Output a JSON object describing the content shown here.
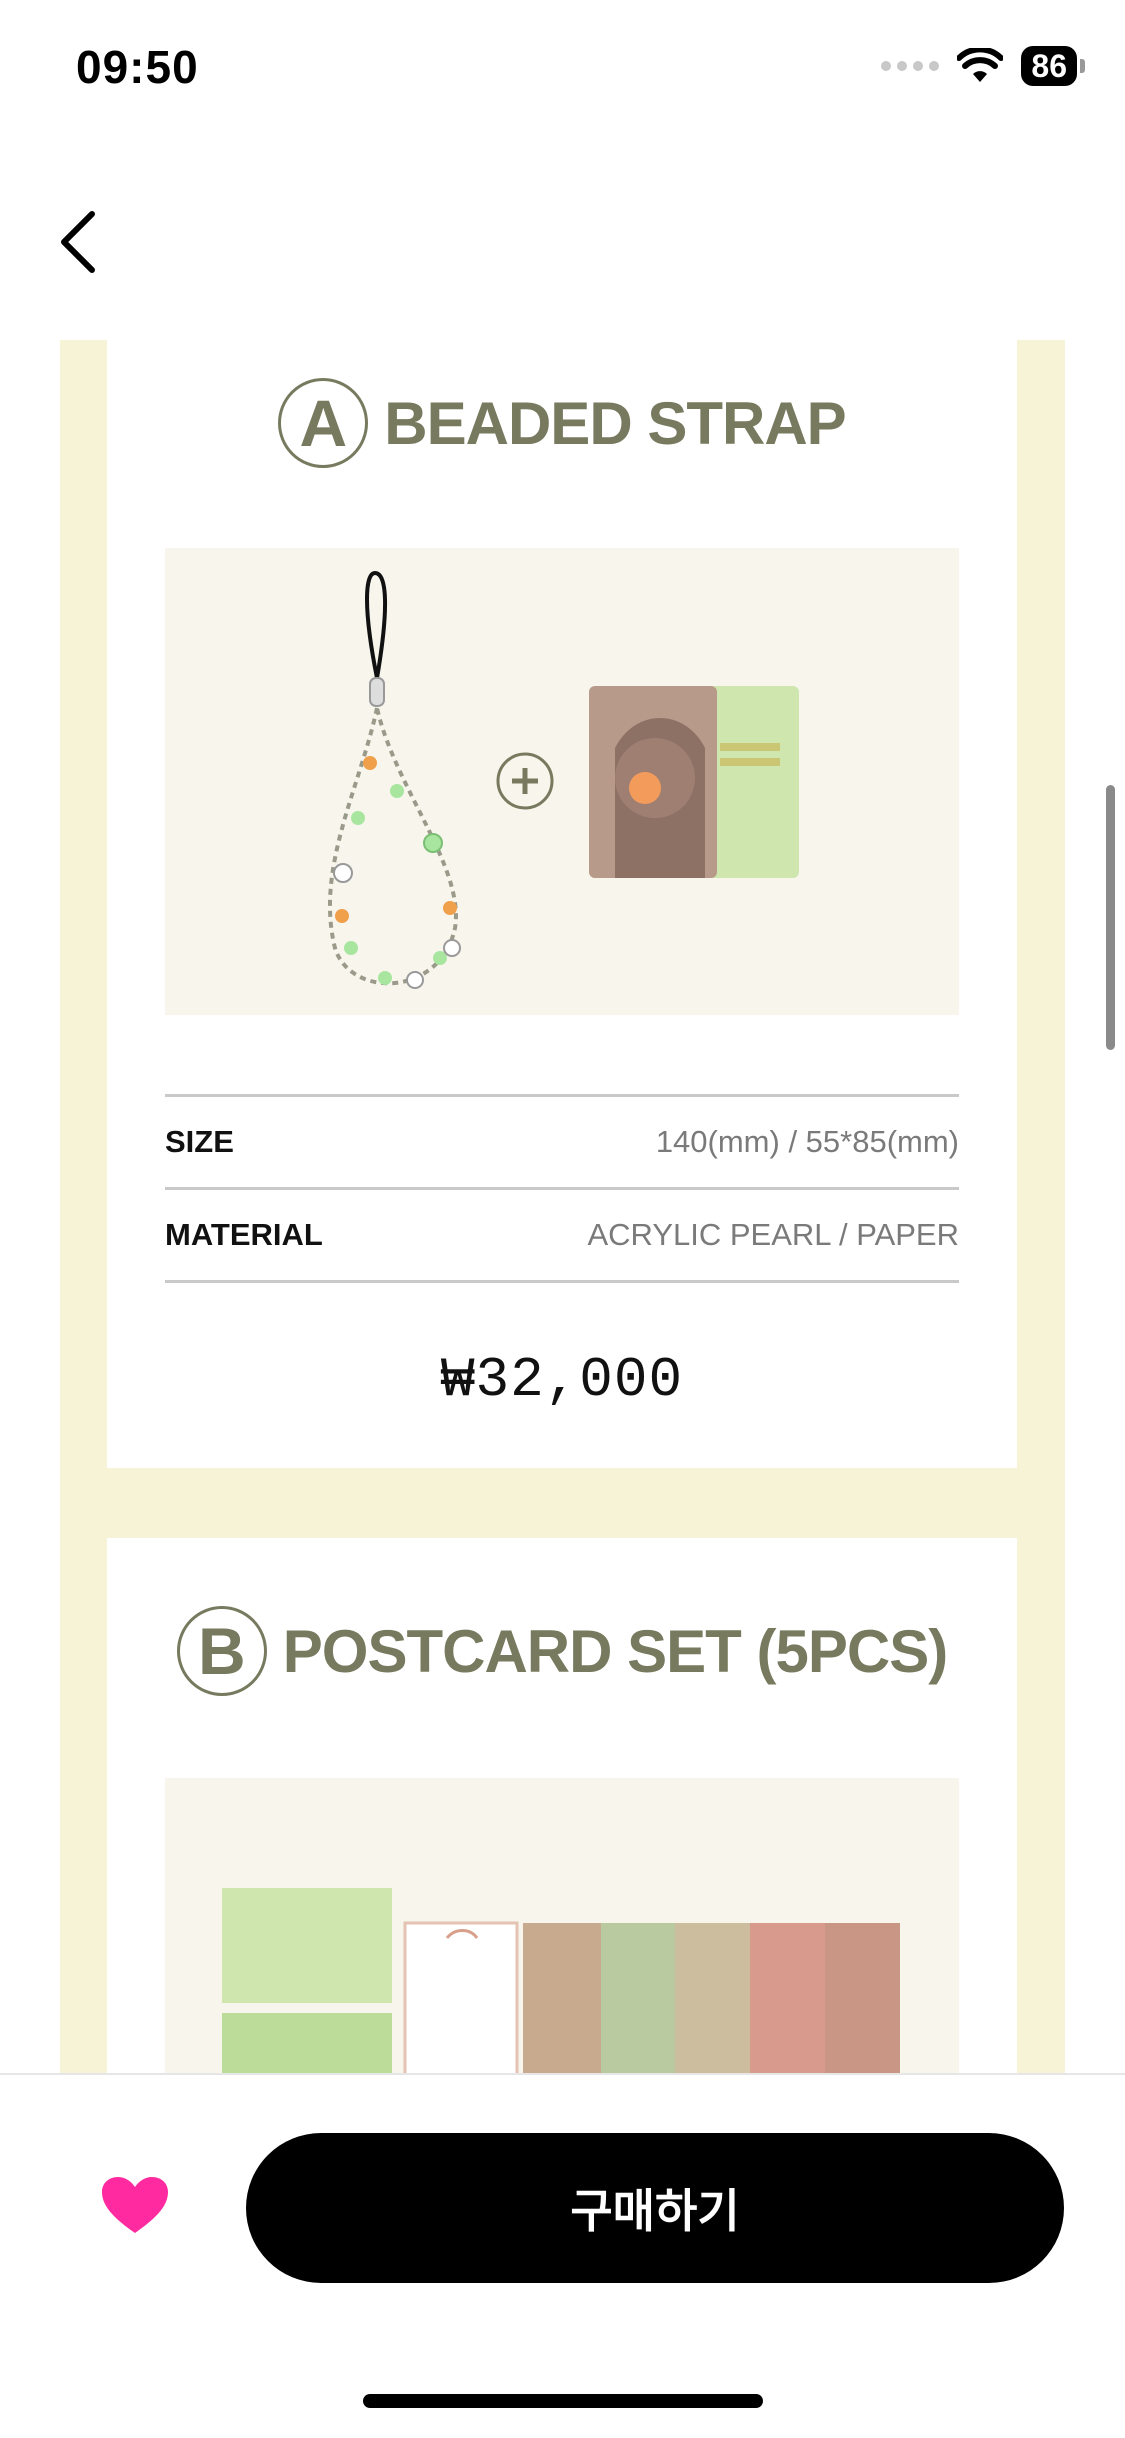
{
  "status_bar": {
    "time": "09:50",
    "battery": "86"
  },
  "nav": {
    "back_icon": "chevron-left-icon"
  },
  "sections": [
    {
      "letter": "A",
      "title": "BEADED STRAP",
      "specs": [
        {
          "label": "SIZE",
          "value": "140(mm) / 55*85(mm)"
        },
        {
          "label": "MATERIAL",
          "value": "ACRYLIC PEARL / PAPER"
        }
      ],
      "price": "₩32,000"
    },
    {
      "letter": "B",
      "title": "POSTCARD SET (5PCS)"
    }
  ],
  "bottom_bar": {
    "buy_label": "구매하기",
    "like_icon": "heart-icon"
  },
  "colors": {
    "accent_text": "#777a5e",
    "background_yellow": "#f7f3d6",
    "heart_pink": "#ff2aa0",
    "buy_button": "#000000"
  }
}
